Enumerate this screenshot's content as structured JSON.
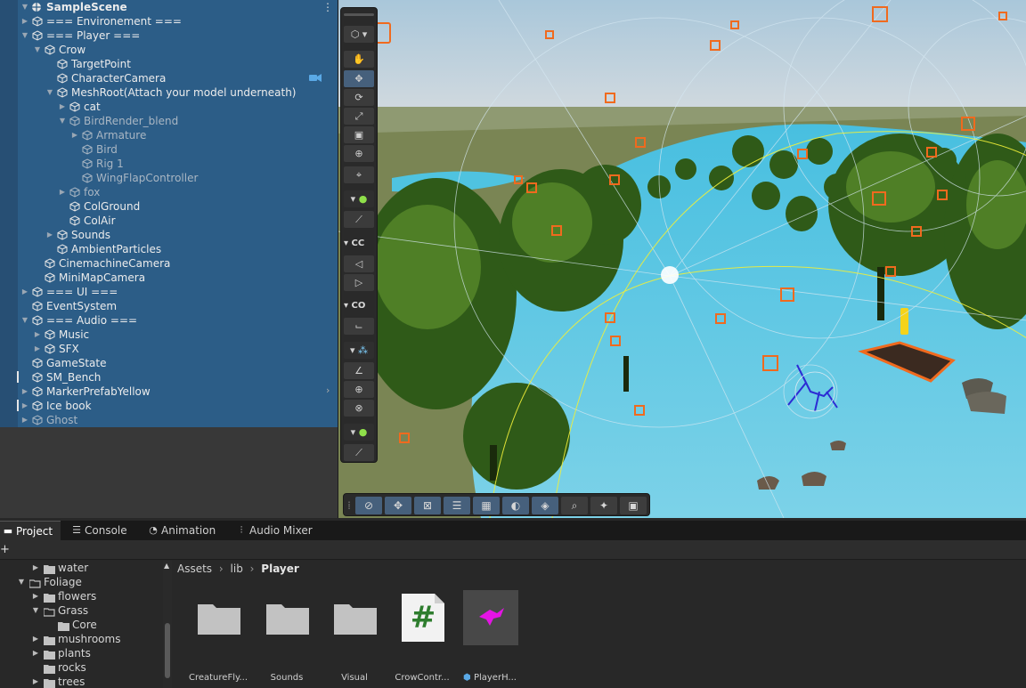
{
  "hierarchy": {
    "scene_name": "SampleScene",
    "items": [
      {
        "label": "=== Environement ===",
        "depth": 1,
        "expanded": false,
        "dim": false
      },
      {
        "label": "=== Player ===",
        "depth": 1,
        "expanded": true,
        "dim": false
      },
      {
        "label": "Crow",
        "depth": 2,
        "expanded": true,
        "dim": false
      },
      {
        "label": "TargetPoint",
        "depth": 3,
        "leaf": true,
        "dim": false
      },
      {
        "label": "CharacterCamera",
        "depth": 3,
        "leaf": true,
        "dim": false
      },
      {
        "label": "MeshRoot(Attach your model underneath)",
        "depth": 3,
        "expanded": true,
        "dim": false
      },
      {
        "label": "cat",
        "depth": 4,
        "expanded": false,
        "dim": false
      },
      {
        "label": "BirdRender_blend",
        "depth": 4,
        "expanded": true,
        "dim": true
      },
      {
        "label": "Armature",
        "depth": 5,
        "expanded": false,
        "dim": true
      },
      {
        "label": "Bird",
        "depth": 5,
        "leaf": true,
        "dim": true
      },
      {
        "label": "Rig 1",
        "depth": 5,
        "leaf": true,
        "dim": true
      },
      {
        "label": "WingFlapController",
        "depth": 5,
        "leaf": true,
        "dim": true
      },
      {
        "label": "fox",
        "depth": 4,
        "expanded": false,
        "dim": true
      },
      {
        "label": "ColGround",
        "depth": 4,
        "leaf": true,
        "dim": false
      },
      {
        "label": "ColAir",
        "depth": 4,
        "leaf": true,
        "dim": false
      },
      {
        "label": "Sounds",
        "depth": 3,
        "expanded": false,
        "dim": false
      },
      {
        "label": "AmbientParticles",
        "depth": 3,
        "leaf": true,
        "dim": false
      },
      {
        "label": "CinemachineCamera",
        "depth": 2,
        "leaf": true,
        "dim": false
      },
      {
        "label": "MiniMapCamera",
        "depth": 2,
        "leaf": true,
        "dim": false
      },
      {
        "label": "=== UI ===",
        "depth": 1,
        "expanded": false,
        "dim": false
      },
      {
        "label": "EventSystem",
        "depth": 1,
        "leaf": true,
        "dim": false
      },
      {
        "label": "=== Audio ===",
        "depth": 1,
        "expanded": true,
        "dim": false
      },
      {
        "label": "Music",
        "depth": 2,
        "expanded": false,
        "dim": false
      },
      {
        "label": "SFX",
        "depth": 2,
        "expanded": false,
        "dim": false
      },
      {
        "label": "GameState",
        "depth": 1,
        "leaf": true,
        "dim": false
      },
      {
        "label": "SM_Bench",
        "depth": 1,
        "leaf": true,
        "dim": false
      },
      {
        "label": "MarkerPrefabYellow",
        "depth": 1,
        "expanded": false,
        "dim": false
      },
      {
        "label": "Ice book",
        "depth": 1,
        "expanded": false,
        "dim": false
      },
      {
        "label": "Ghost",
        "depth": 1,
        "expanded": false,
        "dim": true
      }
    ]
  },
  "scene_toolbar": {
    "group_labels": [
      "CC",
      "CO"
    ],
    "tools": [
      "view-tool",
      "move-tool",
      "rotate-tool",
      "scale-tool",
      "rect-tool",
      "transform-tool",
      "custom-tool"
    ]
  },
  "bottom_tabs": [
    {
      "label": "Project",
      "icon": "folder-icon",
      "active": true
    },
    {
      "label": "Console",
      "icon": "console-icon",
      "active": false
    },
    {
      "label": "Animation",
      "icon": "animation-icon",
      "active": false
    },
    {
      "label": "Audio Mixer",
      "icon": "mixer-icon",
      "active": false
    }
  ],
  "project_tree": [
    {
      "label": "water",
      "depth": 2,
      "expanded": false
    },
    {
      "label": "Foliage",
      "depth": 1,
      "expanded": true
    },
    {
      "label": "flowers",
      "depth": 2,
      "expanded": false
    },
    {
      "label": "Grass",
      "depth": 2,
      "expanded": true
    },
    {
      "label": "Core",
      "depth": 3,
      "leaf": true
    },
    {
      "label": "mushrooms",
      "depth": 2,
      "expanded": false
    },
    {
      "label": "plants",
      "depth": 2,
      "expanded": false
    },
    {
      "label": "rocks",
      "depth": 2,
      "leaf": true
    },
    {
      "label": "trees",
      "depth": 2,
      "expanded": false
    }
  ],
  "breadcrumb": [
    "Assets",
    "lib",
    "Player"
  ],
  "assets": [
    {
      "label": "CreatureFly...",
      "kind": "folder"
    },
    {
      "label": "Sounds",
      "kind": "folder"
    },
    {
      "label": "Visual",
      "kind": "folder"
    },
    {
      "label": "CrowContr...",
      "kind": "script",
      "glyph": "#"
    },
    {
      "label": "PlayerH...",
      "kind": "prefab"
    }
  ],
  "colors": {
    "selection": "#2c5d87",
    "accent_orange": "#f06a1e",
    "water": "#4fc3e0",
    "tree": "#3f6b1f"
  }
}
